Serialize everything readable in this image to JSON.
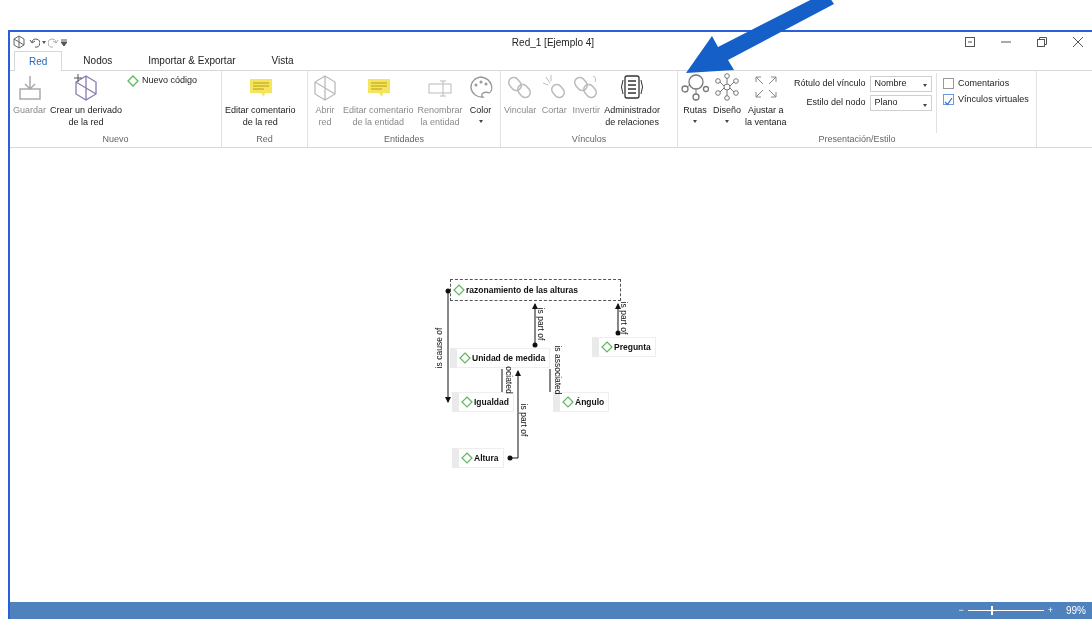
{
  "window": {
    "title": "Red_1 [Ejemplo 4]"
  },
  "tabs": [
    {
      "label": "Red",
      "selected": true
    },
    {
      "label": "Nodos",
      "selected": false
    },
    {
      "label": "Importar & Exportar",
      "selected": false
    },
    {
      "label": "Vista",
      "selected": false
    }
  ],
  "ribbon": [
    {
      "label": "Nuevo",
      "items": [
        {
          "kind": "large",
          "lines": [
            "Guardar"
          ],
          "disabled": true
        },
        {
          "kind": "large",
          "lines": [
            "Crear un derivado",
            "de la red"
          ],
          "disabled": false
        },
        {
          "kind": "small",
          "lines": [
            "Nuevo código"
          ]
        }
      ]
    },
    {
      "label": "Red",
      "items": [
        {
          "kind": "large",
          "lines": [
            "Editar comentario",
            "de la red"
          ],
          "disabled": false
        }
      ]
    },
    {
      "label": "Entidades",
      "items": [
        {
          "kind": "large",
          "lines": [
            "Abrir",
            "red"
          ],
          "disabled": true
        },
        {
          "kind": "large",
          "lines": [
            "Editar comentario",
            "de la entidad"
          ],
          "disabled": true
        },
        {
          "kind": "large",
          "lines": [
            "Renombrar",
            "la entidad"
          ],
          "disabled": true
        },
        {
          "kind": "menu",
          "lines": [
            "Color"
          ],
          "disabled": false
        }
      ]
    },
    {
      "label": "Vínculos",
      "items": [
        {
          "kind": "large",
          "lines": [
            "Vincular"
          ],
          "disabled": true
        },
        {
          "kind": "large",
          "lines": [
            "Cortar"
          ],
          "disabled": true
        },
        {
          "kind": "large",
          "lines": [
            "Invertir"
          ],
          "disabled": true
        },
        {
          "kind": "large",
          "lines": [
            "Administrador",
            "de relaciones"
          ],
          "disabled": false
        }
      ]
    },
    {
      "label": "Presentación/Estilo",
      "items": [
        {
          "kind": "menu",
          "lines": [
            "Rutas"
          ],
          "disabled": false
        },
        {
          "kind": "menu",
          "lines": [
            "Diseño"
          ],
          "disabled": false
        },
        {
          "kind": "large",
          "lines": [
            "Ajustar a",
            "la ventana"
          ],
          "disabled": false
        },
        {
          "kind": "selects",
          "rows": [
            {
              "label": "Rótulo del vínculo",
              "value": "Nombre"
            },
            {
              "label": "Estilo del nodo",
              "value": "Plano"
            }
          ]
        },
        {
          "kind": "checks",
          "rows": [
            {
              "label": "Comentarios",
              "checked": false
            },
            {
              "label": "Vínculos virtuales",
              "checked": true
            }
          ]
        }
      ]
    }
  ],
  "diagram": {
    "nodes": [
      {
        "label": "razonamiento de las alturas",
        "selected": true
      },
      {
        "label": "Pregunta",
        "selected": false
      },
      {
        "label": "Unidad de medida",
        "selected": false
      },
      {
        "label": "Igualdad",
        "selected": false
      },
      {
        "label": "Ángulo",
        "selected": false
      },
      {
        "label": "Altura",
        "selected": false
      }
    ],
    "links": [
      {
        "label": "is cause of"
      },
      {
        "label": "is part of"
      },
      {
        "label": "is part of"
      },
      {
        "label": "ociated"
      },
      {
        "label": "is associated"
      },
      {
        "label": "is part of"
      }
    ]
  },
  "status_bar": {
    "zoom_out": "−",
    "zoom_in": "+",
    "level": 0.3,
    "zoom": "99%"
  }
}
